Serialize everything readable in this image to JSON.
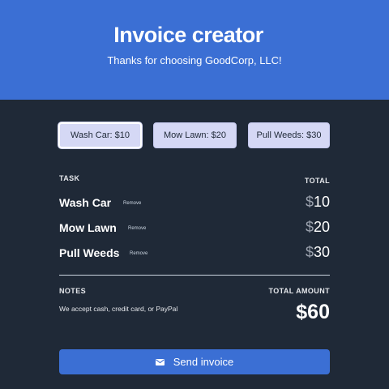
{
  "header": {
    "title": "Invoice creator",
    "subtitle": "Thanks for choosing GoodCorp, LLC!"
  },
  "services": [
    {
      "label": "Wash Car: $10",
      "active": true
    },
    {
      "label": "Mow Lawn: $20",
      "active": false
    },
    {
      "label": "Pull Weeds: $30",
      "active": false
    }
  ],
  "table": {
    "task_header": "TASK",
    "total_header": "TOTAL",
    "rows": [
      {
        "task": "Wash Car",
        "remove": "Remove",
        "currency": "$",
        "amount": "10"
      },
      {
        "task": "Mow Lawn",
        "remove": "Remove",
        "currency": "$",
        "amount": "20"
      },
      {
        "task": "Pull Weeds",
        "remove": "Remove",
        "currency": "$",
        "amount": "30"
      }
    ]
  },
  "summary": {
    "notes_header": "NOTES",
    "notes_text": "We accept cash, credit card, or PayPal",
    "total_header": "TOTAL AMOUNT",
    "total_amount": "$60"
  },
  "send_button": {
    "label": "Send invoice",
    "icon": "envelope-icon"
  },
  "colors": {
    "header_bg": "#3b6fd4",
    "body_bg": "#1f2937",
    "chip_bg": "#d5d8f5",
    "button_bg": "#3b6fd4"
  }
}
